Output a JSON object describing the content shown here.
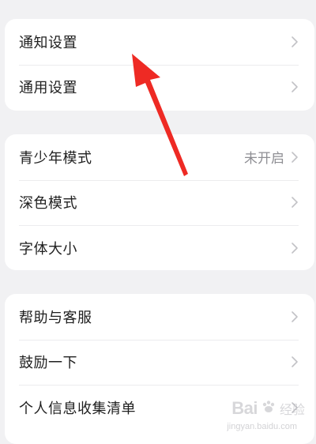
{
  "groups": [
    {
      "items": [
        {
          "label": "通知设置",
          "value": ""
        },
        {
          "label": "通用设置",
          "value": ""
        }
      ]
    },
    {
      "items": [
        {
          "label": "青少年模式",
          "value": "未开启"
        },
        {
          "label": "深色模式",
          "value": ""
        },
        {
          "label": "字体大小",
          "value": ""
        }
      ]
    },
    {
      "items": [
        {
          "label": "帮助与客服",
          "value": ""
        },
        {
          "label": "鼓励一下",
          "value": ""
        },
        {
          "label": "个人信息收集清单",
          "value": ""
        }
      ]
    }
  ],
  "annotation": {
    "color": "#ee2a24",
    "icon": "red-pointer-arrow-icon"
  },
  "watermark": {
    "brand": "Bai",
    "text": "经验",
    "url": "jingyan.baidu.com"
  }
}
